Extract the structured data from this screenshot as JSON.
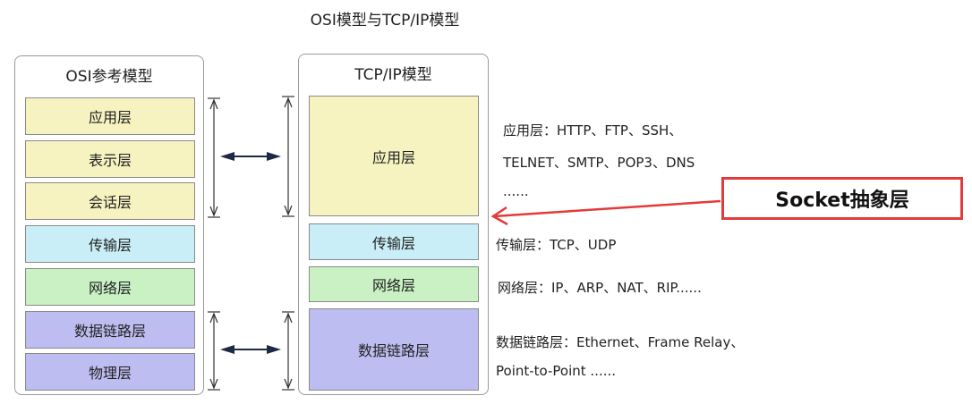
{
  "title": "OSI模型与TCP/IP模型",
  "osi": {
    "title": "OSI参考模型",
    "layers": [
      "应用层",
      "表示层",
      "会话层",
      "传输层",
      "网络层",
      "数据链路层",
      "物理层"
    ]
  },
  "tcpip": {
    "title": "TCP/IP模型",
    "layers": [
      "应用层",
      "传输层",
      "网络层",
      "数据链路层"
    ]
  },
  "notes": {
    "app_line1": "应用层：HTTP、FTP、SSH、",
    "app_line2": "TELNET、SMTP、POP3、DNS",
    "app_line3": "......",
    "transport": "传输层：TCP、UDP",
    "network": "网络层：IP、ARP、NAT、RIP......",
    "datalink_line1": "数据链路层：Ethernet、Frame Relay、",
    "datalink_line2": "Point-to-Point ......"
  },
  "socket_label": "Socket抽象层",
  "colors": {
    "yellow": "#f6f3c1",
    "cyan": "#c9eef7",
    "green": "#c9f1c4",
    "purple": "#bdbdf1",
    "socket_border": "#e53a3a",
    "arrow": "#e53a3a"
  }
}
